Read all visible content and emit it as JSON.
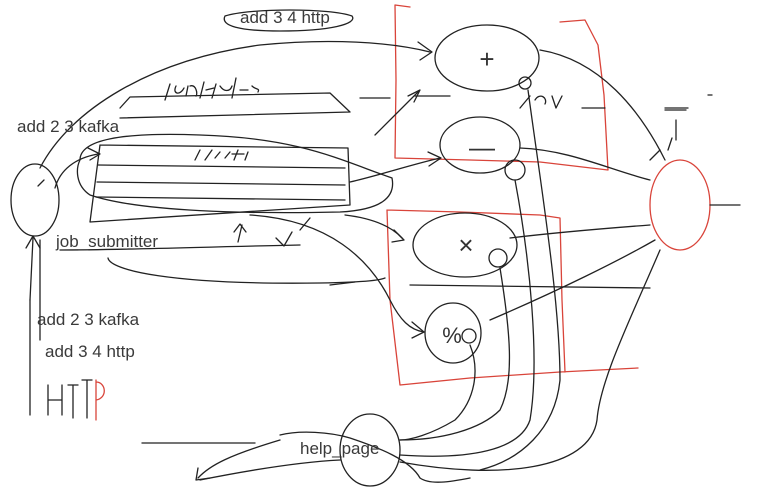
{
  "labels": {
    "add_3_4_http_top": "add 3 4 http",
    "add_2_3_kafka": "add 2 3 kafka",
    "job_submitter": "job_submitter",
    "note_add_2_3_kafka": "add 2 3 kafka",
    "note_add_3_4_http": "add 3 4 http",
    "help_page": "help_page"
  },
  "operators": {
    "plus": "+",
    "minus": "—",
    "times": "×",
    "divide": "%"
  },
  "colors": {
    "ink": "#222222",
    "red_ink": "#d9443a",
    "label_text": "#3a3a3a",
    "background": "#ffffff"
  }
}
